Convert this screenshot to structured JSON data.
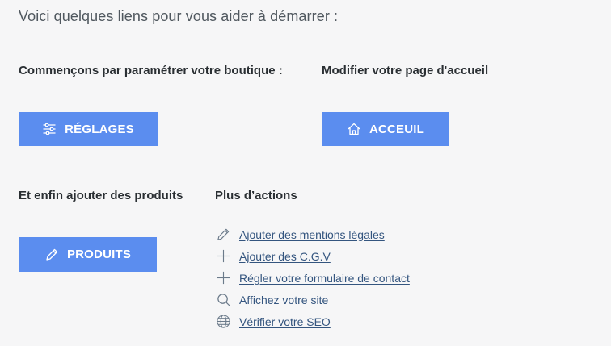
{
  "intro": "Voici quelques liens pour vous aider à démarrer :",
  "settings": {
    "heading": "Commençons par paramétrer votre boutique :",
    "button_label": "RÉGLAGES",
    "icon": "sliders-icon"
  },
  "home": {
    "heading": "Modifier votre page d'accueil",
    "button_label": "ACCEUIL",
    "icon": "home-icon"
  },
  "products": {
    "heading": "Et enfin ajouter des produits",
    "button_label": "PRODUITS",
    "icon": "pencil-icon"
  },
  "more_actions": {
    "heading": "Plus d’actions",
    "items": [
      {
        "label": "Ajouter des mentions légales",
        "icon": "pencil-icon"
      },
      {
        "label": "Ajouter des C.G.V",
        "icon": "plus-icon"
      },
      {
        "label": "Régler votre formulaire de contact",
        "icon": "plus-icon"
      },
      {
        "label": "Affichez votre site",
        "icon": "search-icon"
      },
      {
        "label": "Vérifier votre SEO",
        "icon": "globe-icon"
      }
    ]
  },
  "colors": {
    "background": "#f6f6f7",
    "button": "#5b8def",
    "link": "#34557f",
    "icon": "#6b7a8a"
  }
}
